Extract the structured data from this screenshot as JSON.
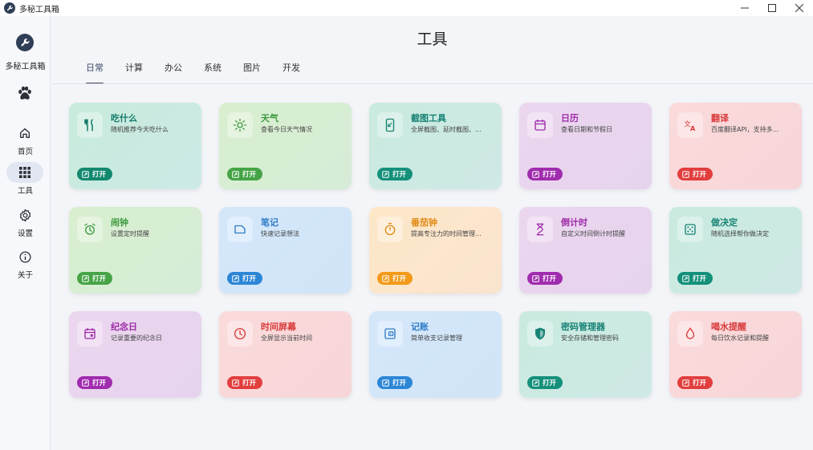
{
  "window": {
    "title": "多秘工具箱",
    "controls": [
      "minimize",
      "maximize",
      "close"
    ]
  },
  "sidebar": {
    "brand": "多秘工具箱",
    "items": [
      {
        "label": "首页",
        "icon": "home-icon",
        "active": false
      },
      {
        "label": "工具",
        "icon": "grid-icon",
        "active": true
      },
      {
        "label": "设置",
        "icon": "gear-icon",
        "active": false
      },
      {
        "label": "关于",
        "icon": "info-icon",
        "active": false
      }
    ]
  },
  "main": {
    "title": "工具",
    "tabs": [
      {
        "label": "日常",
        "active": true
      },
      {
        "label": "计算",
        "active": false
      },
      {
        "label": "办公",
        "active": false
      },
      {
        "label": "系统",
        "active": false
      },
      {
        "label": "图片",
        "active": false
      },
      {
        "label": "开发",
        "active": false
      }
    ],
    "open_label": "打开",
    "cards": [
      {
        "title": "吃什么",
        "desc": "随机推荐今天吃什么",
        "icon": "fork-knife-icon",
        "theme": "teal"
      },
      {
        "title": "天气",
        "desc": "查看今日天气情况",
        "icon": "sun-icon",
        "theme": "green"
      },
      {
        "title": "截图工具",
        "desc": "全屏截图、延时截图、...",
        "icon": "screenshot-icon",
        "theme": "mint"
      },
      {
        "title": "日历",
        "desc": "查看日期和节假日",
        "icon": "calendar-icon",
        "theme": "purple"
      },
      {
        "title": "翻译",
        "desc": "百度翻译API，支持多...",
        "icon": "translate-icon",
        "theme": "red"
      },
      {
        "title": "闹钟",
        "desc": "设置定时提醒",
        "icon": "alarm-icon",
        "theme": "green"
      },
      {
        "title": "笔记",
        "desc": "快速记录想法",
        "icon": "note-icon",
        "theme": "blue"
      },
      {
        "title": "番茄钟",
        "desc": "提高专注力的时间管理...",
        "icon": "timer-icon",
        "theme": "orange"
      },
      {
        "title": "倒计时",
        "desc": "自定义时间倒计时提醒",
        "icon": "hourglass-icon",
        "theme": "purple"
      },
      {
        "title": "做决定",
        "desc": "随机选择帮你做决定",
        "icon": "dice-icon",
        "theme": "mint"
      },
      {
        "title": "纪念日",
        "desc": "记录重要的纪念日",
        "icon": "event-icon",
        "theme": "purple"
      },
      {
        "title": "时间屏幕",
        "desc": "全屏显示当前时间",
        "icon": "clock-icon",
        "theme": "red"
      },
      {
        "title": "记账",
        "desc": "简单收支记录管理",
        "icon": "wallet-icon",
        "theme": "blue"
      },
      {
        "title": "密码管理器",
        "desc": "安全存储和管理密码",
        "icon": "shield-icon",
        "theme": "mint"
      },
      {
        "title": "喝水提醒",
        "desc": "每日饮水记录和提醒",
        "icon": "water-drop-icon",
        "theme": "red"
      }
    ]
  }
}
